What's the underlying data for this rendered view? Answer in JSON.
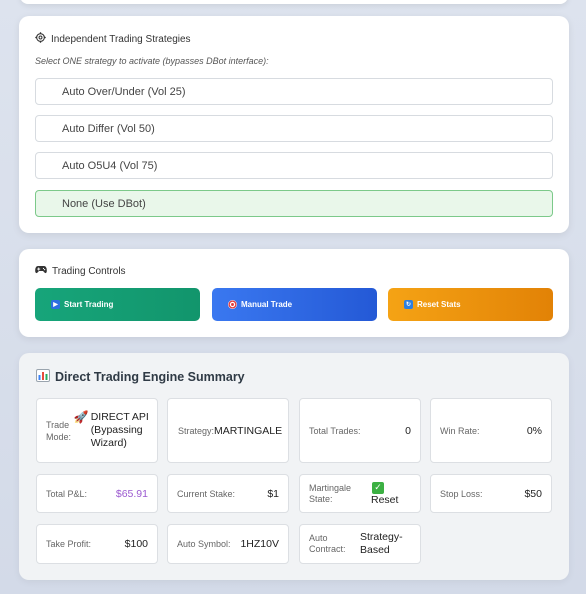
{
  "strategies": {
    "title": "Independent Trading Strategies",
    "icon": "gear-icon",
    "subtitle": "Select ONE strategy to activate (bypasses DBot interface):",
    "options": [
      {
        "label": "Auto Over/Under (Vol 25)",
        "selected": false
      },
      {
        "label": "Auto Differ (Vol 50)",
        "selected": false
      },
      {
        "label": "Auto O5U4 (Vol 75)",
        "selected": false
      },
      {
        "label": "None (Use DBot)",
        "selected": true
      }
    ]
  },
  "controls": {
    "title": "Trading Controls",
    "icon": "gamepad-icon",
    "buttons": {
      "start": {
        "label": "Start Trading",
        "icon": "play-icon",
        "color": "#17a57a"
      },
      "manual": {
        "label": "Manual Trade",
        "icon": "target-icon",
        "color": "#2f6de6"
      },
      "reset": {
        "label": "Reset Stats",
        "icon": "refresh-icon",
        "color": "#ee9410"
      }
    }
  },
  "summary": {
    "title": "Direct Trading Engine Summary",
    "icon": "bar-chart-icon",
    "trade_mode": {
      "label": "Trade Mode:",
      "value": "DIRECT API (Bypassing Wizard)",
      "icon": "rocket-icon"
    },
    "strategy": {
      "label": "Strategy:",
      "value": "MARTINGALE"
    },
    "total_trades": {
      "label": "Total Trades:",
      "value": "0"
    },
    "win_rate": {
      "label": "Win Rate:",
      "value": "0%"
    },
    "total_pnl": {
      "label": "Total P&L:",
      "value": "$65.91",
      "color": "#9b59d0"
    },
    "current_stake": {
      "label": "Current Stake:",
      "value": "$1"
    },
    "martingale_state": {
      "label": "Martingale State:",
      "value": "Reset",
      "icon": "check-icon"
    },
    "stop_loss": {
      "label": "Stop Loss:",
      "value": "$50"
    },
    "take_profit": {
      "label": "Take Profit:",
      "value": "$100"
    },
    "auto_symbol": {
      "label": "Auto Symbol:",
      "value": "1HZ10V"
    },
    "auto_contract": {
      "label": "Auto Contract:",
      "value": "Strategy-Based"
    }
  }
}
